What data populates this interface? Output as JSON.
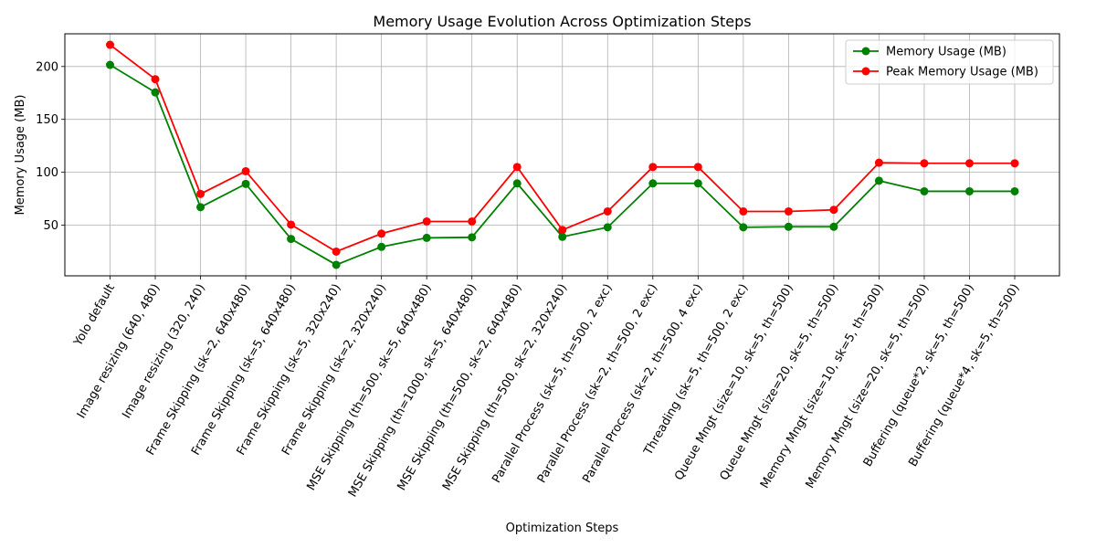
{
  "chart_data": {
    "type": "line",
    "title": "Memory Usage Evolution Across Optimization Steps",
    "xlabel": "Optimization Steps",
    "ylabel": "Memory Usage (MB)",
    "categories": [
      "Yolo default",
      "Image resizing (640, 480)",
      "Image resizing (320, 240)",
      "Frame Skipping (sk=2, 640x480)",
      "Frame Skipping (sk=5, 640x480)",
      "Frame Skipping (sk=5, 320x240)",
      "Frame Skipping (sk=2, 320x240)",
      "MSE Skipping (th=500, sk=5, 640x480)",
      "MSE Skipping (th=1000, sk=5, 640x480)",
      "MSE Skipping (th=500, sk=2, 640x480)",
      "MSE Skipping (th=500, sk=2, 320x240)",
      "Parallel Process (sk=5, th=500, 2 exc)",
      "Parallel Process (sk=2, th=500, 2 exc)",
      "Parallel Process (sk=2, th=500, 4 exc)",
      "Threading (sk=5, th=500, 2 exc)",
      "Queue Mngt (size=10, sk=5, th=500)",
      "Queue Mngt (size=20, sk=5, th=500)",
      "Memory Mngt (size=10, sk=5, th=500)",
      "Memory Mngt (size=20, sk=5, th=500)",
      "Buffering (queue*2, sk=5, th=500)",
      "Buffering (queue*4, sk=5, th=500)"
    ],
    "series": [
      {
        "name": "Memory Usage (MB)",
        "color": "#008000",
        "values": [
          201.5,
          175.5,
          67,
          89,
          37,
          12.5,
          29.5,
          38,
          38.5,
          89.5,
          39,
          48,
          89.5,
          89.5,
          48,
          48.5,
          48.5,
          92,
          82,
          82,
          82
        ]
      },
      {
        "name": "Peak Memory Usage (MB)",
        "color": "#ff0000",
        "values": [
          220.5,
          188,
          79.5,
          101,
          50.5,
          25,
          42,
          53.5,
          53.5,
          105,
          45.5,
          63,
          105,
          105,
          63,
          63,
          64.5,
          109,
          108.5,
          108.5,
          108.5
        ]
      }
    ],
    "yticks": [
      50,
      100,
      150,
      200
    ],
    "ylim": [
      2.1,
      230.9
    ],
    "grid": true,
    "legend_position": "top-right"
  }
}
